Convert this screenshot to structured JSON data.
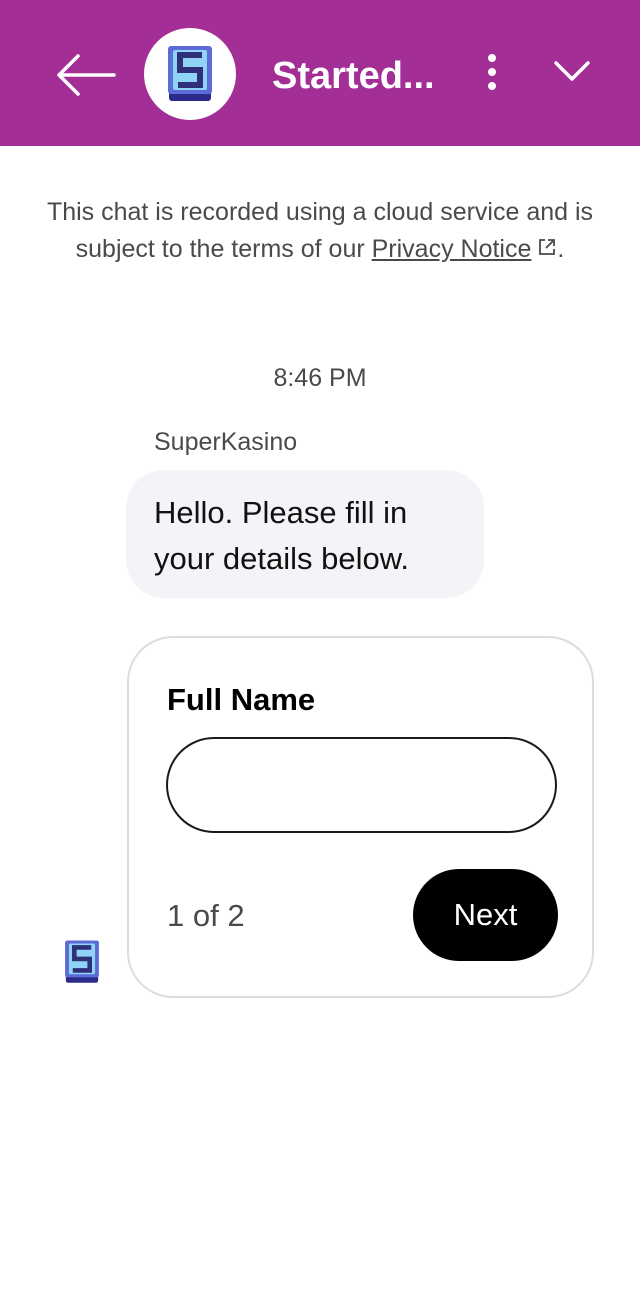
{
  "header": {
    "title": "Started...",
    "background_color": "#a22e96",
    "icons": [
      "back-arrow-icon",
      "superkasino-logo",
      "more-vertical-icon",
      "chevron-down-icon"
    ]
  },
  "notice": {
    "text_before": "This chat is recorded using a cloud service and is subject to the terms of our ",
    "link_text": "Privacy Notice",
    "text_after": "."
  },
  "conversation": {
    "timestamp": "8:46 PM",
    "sender": "SuperKasino",
    "message": "Hello. Please fill in your details below."
  },
  "form": {
    "label": "Full Name",
    "value": "",
    "page_indicator": "1 of 2",
    "next_label": "Next"
  }
}
